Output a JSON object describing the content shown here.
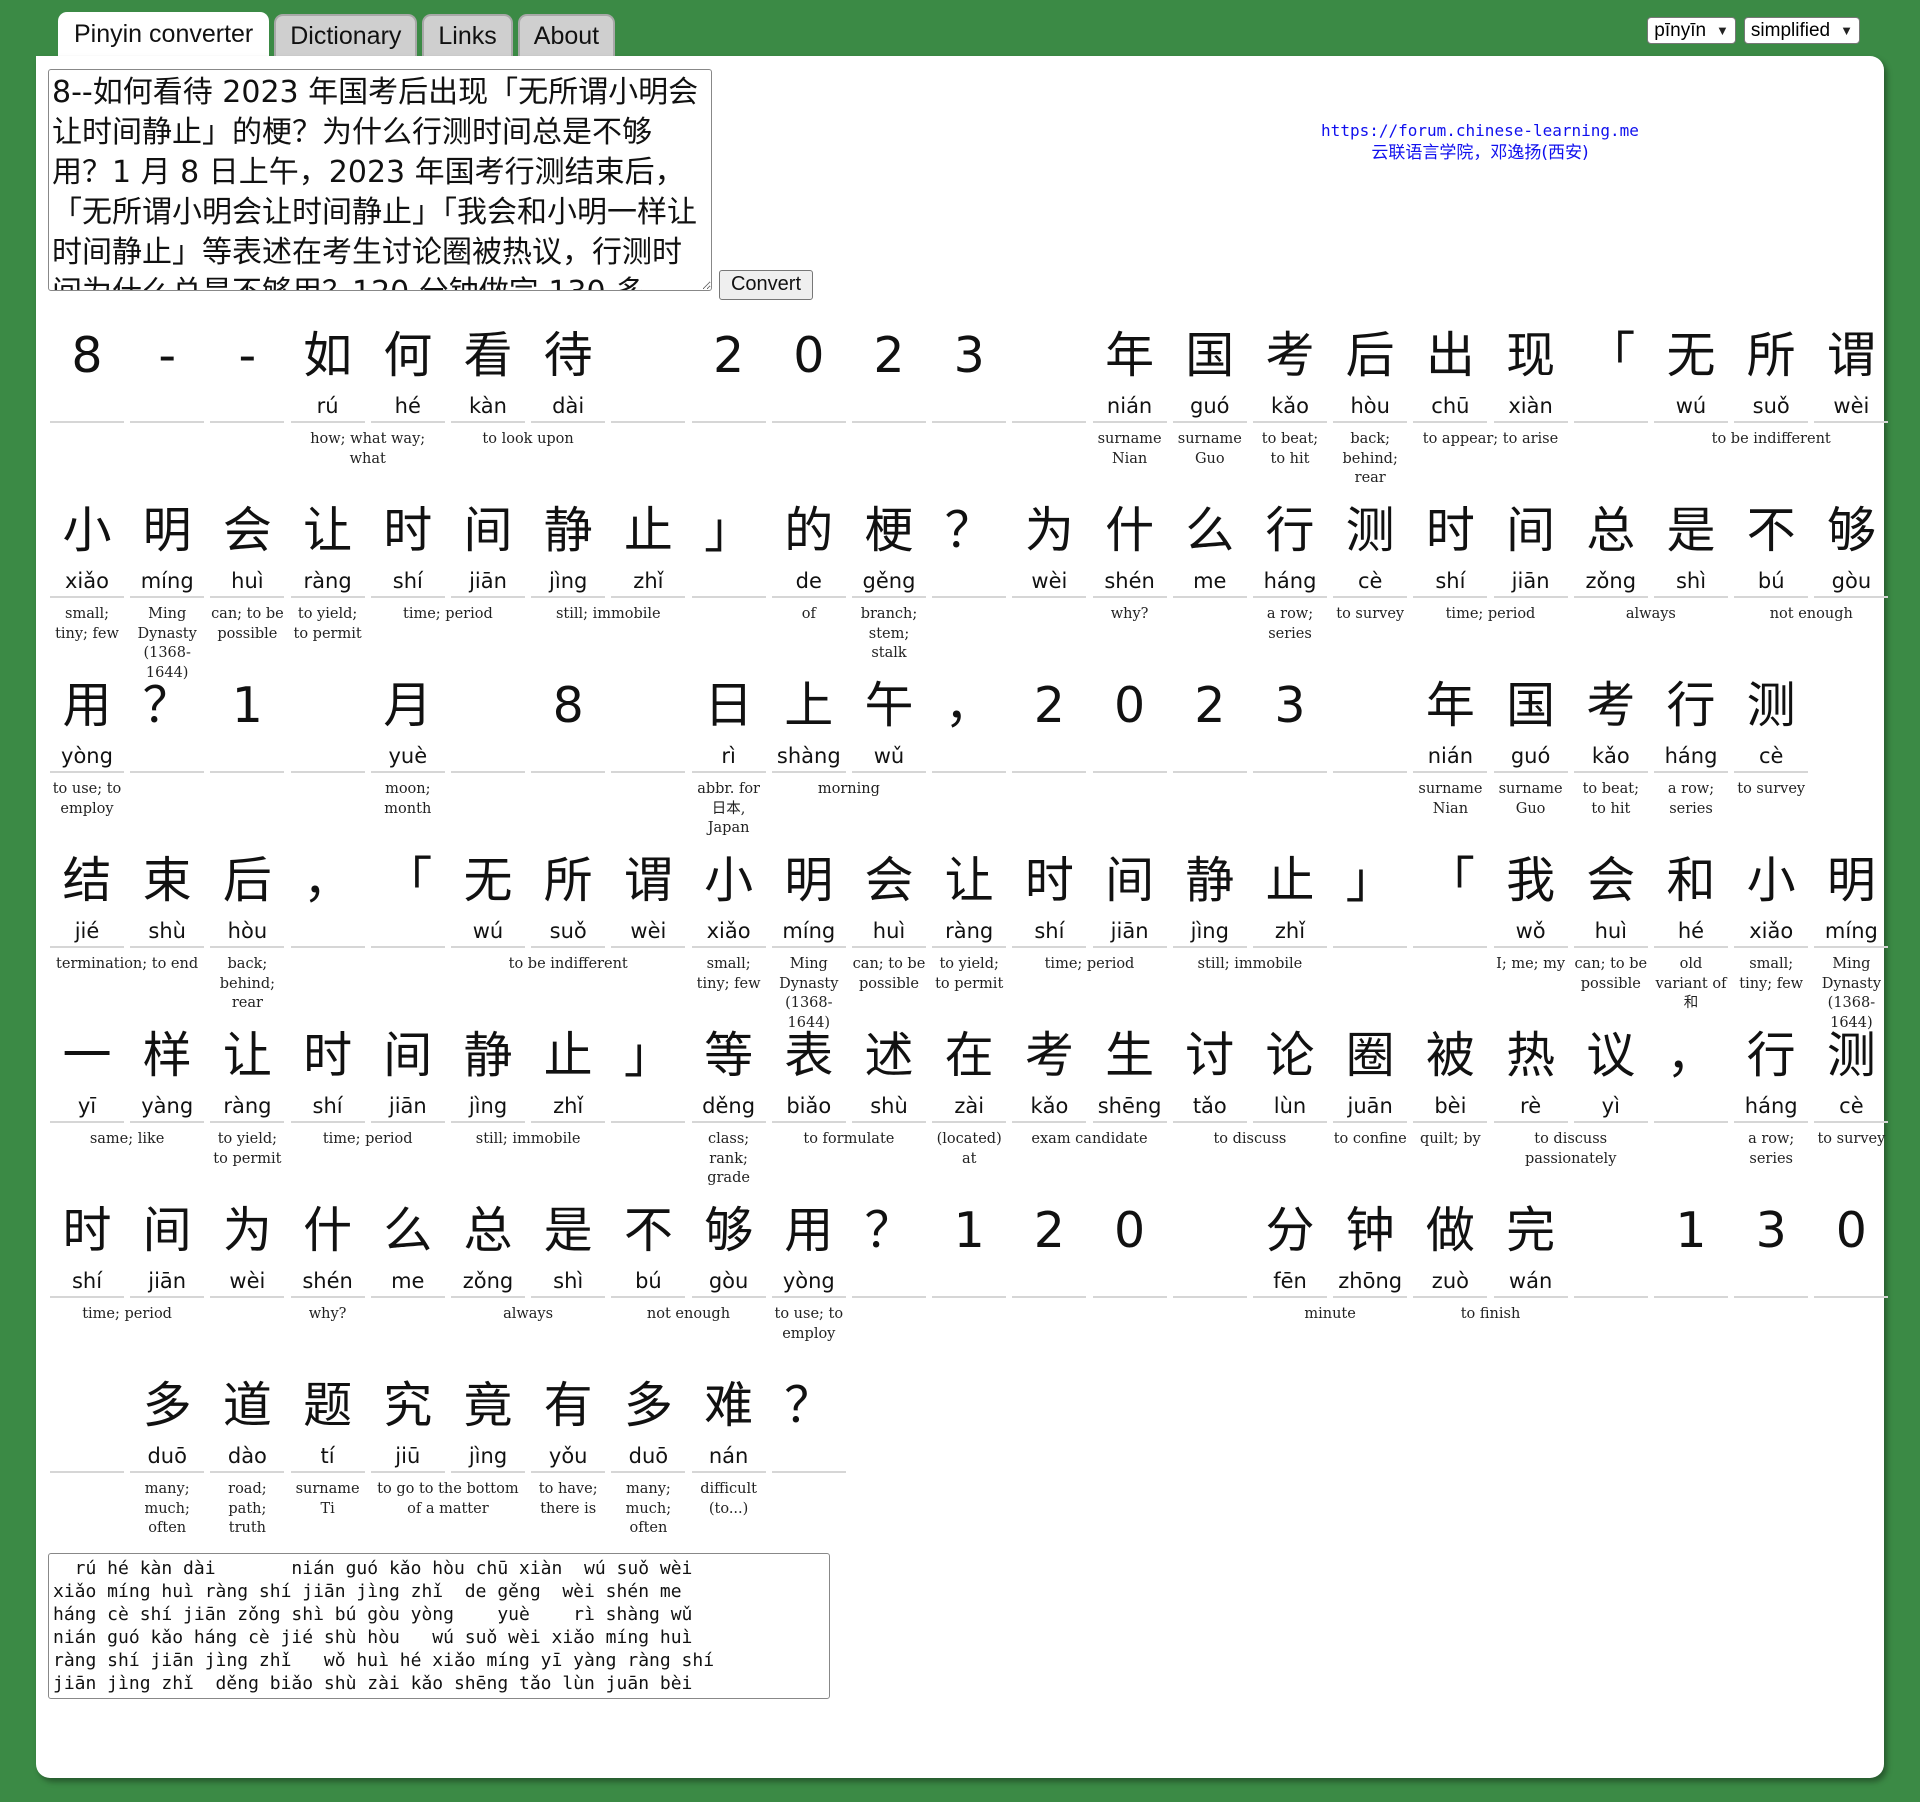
{
  "tabs": [
    "Pinyin converter",
    "Dictionary",
    "Links",
    "About"
  ],
  "active_tab": 0,
  "selects": {
    "mode": "pīnyīn",
    "script": "simplified"
  },
  "input_text": "8--如何看待 2023 年国考后出现「无所谓小明会让时间静止」的梗？为什么行测时间总是不够用？1 月 8 日上午，2023 年国考行测结束后，「无所谓小明会让时间静止」「我会和小明一样让时间静止」等表述在考生讨论圈被热议，行测时间为什么总是不够用？120 分钟做完 130 多",
  "convert_label": "Convert",
  "forum": {
    "url": "https://forum.chinese-learning.me",
    "subtitle": "云联语言学院，邓逸扬(西安)"
  },
  "lines": [
    {
      "cells": [
        {
          "c": "8",
          "p": ""
        },
        {
          "c": "-",
          "p": ""
        },
        {
          "c": "-",
          "p": ""
        },
        {
          "c": "如",
          "p": "rú"
        },
        {
          "c": "何",
          "p": "hé"
        },
        {
          "c": "看",
          "p": "kàn"
        },
        {
          "c": "待",
          "p": "dài"
        },
        {
          "c": "",
          "p": ""
        },
        {
          "c": "2",
          "p": ""
        },
        {
          "c": "0",
          "p": ""
        },
        {
          "c": "2",
          "p": ""
        },
        {
          "c": "3",
          "p": ""
        },
        {
          "c": "",
          "p": ""
        },
        {
          "c": "年",
          "p": "nián"
        },
        {
          "c": "国",
          "p": "guó"
        },
        {
          "c": "考",
          "p": "kǎo"
        },
        {
          "c": "后",
          "p": "hòu"
        },
        {
          "c": "出",
          "p": "chū"
        },
        {
          "c": "现",
          "p": "xiàn"
        },
        {
          "c": "「",
          "p": ""
        },
        {
          "c": "无",
          "p": "wú"
        },
        {
          "c": "所",
          "p": "suǒ"
        },
        {
          "c": "谓",
          "p": "wèi"
        }
      ],
      "defs": [
        {
          "s": 3,
          "n": 2,
          "t": "how; what way; what"
        },
        {
          "s": 5,
          "n": 2,
          "t": "to look upon"
        },
        {
          "s": 13,
          "n": 1,
          "t": "surname Nian"
        },
        {
          "s": 14,
          "n": 1,
          "t": "surname Guo"
        },
        {
          "s": 15,
          "n": 1,
          "t": "to beat; to hit"
        },
        {
          "s": 16,
          "n": 1,
          "t": "back; behind; rear"
        },
        {
          "s": 17,
          "n": 2,
          "t": "to appear; to arise"
        },
        {
          "s": 20,
          "n": 3,
          "t": "to be indifferent"
        }
      ]
    },
    {
      "cells": [
        {
          "c": "小",
          "p": "xiǎo"
        },
        {
          "c": "明",
          "p": "míng"
        },
        {
          "c": "会",
          "p": "huì"
        },
        {
          "c": "让",
          "p": "ràng"
        },
        {
          "c": "时",
          "p": "shí"
        },
        {
          "c": "间",
          "p": "jiān"
        },
        {
          "c": "静",
          "p": "jìng"
        },
        {
          "c": "止",
          "p": "zhǐ"
        },
        {
          "c": "」",
          "p": ""
        },
        {
          "c": "的",
          "p": "de"
        },
        {
          "c": "梗",
          "p": "gěng"
        },
        {
          "c": "？",
          "p": ""
        },
        {
          "c": "为",
          "p": "wèi"
        },
        {
          "c": "什",
          "p": "shén"
        },
        {
          "c": "么",
          "p": "me"
        },
        {
          "c": "行",
          "p": "háng"
        },
        {
          "c": "测",
          "p": "cè"
        },
        {
          "c": "时",
          "p": "shí"
        },
        {
          "c": "间",
          "p": "jiān"
        },
        {
          "c": "总",
          "p": "zǒng"
        },
        {
          "c": "是",
          "p": "shì"
        },
        {
          "c": "不",
          "p": "bú"
        },
        {
          "c": "够",
          "p": "gòu"
        }
      ],
      "defs": [
        {
          "s": 0,
          "n": 1,
          "t": "small; tiny; few"
        },
        {
          "s": 1,
          "n": 1,
          "t": "Ming Dynasty (1368-1644)"
        },
        {
          "s": 2,
          "n": 1,
          "t": "can; to be possible"
        },
        {
          "s": 3,
          "n": 1,
          "t": "to yield; to permit"
        },
        {
          "s": 4,
          "n": 2,
          "t": "time; period"
        },
        {
          "s": 6,
          "n": 2,
          "t": "still; immobile"
        },
        {
          "s": 9,
          "n": 1,
          "t": "of"
        },
        {
          "s": 10,
          "n": 1,
          "t": "branch; stem; stalk"
        },
        {
          "s": 12,
          "n": 3,
          "t": "why?"
        },
        {
          "s": 15,
          "n": 1,
          "t": "a row; series"
        },
        {
          "s": 16,
          "n": 1,
          "t": "to survey"
        },
        {
          "s": 17,
          "n": 2,
          "t": "time; period"
        },
        {
          "s": 19,
          "n": 2,
          "t": "always"
        },
        {
          "s": 21,
          "n": 2,
          "t": "not enough"
        }
      ]
    },
    {
      "cells": [
        {
          "c": "用",
          "p": "yòng"
        },
        {
          "c": "？",
          "p": ""
        },
        {
          "c": "1",
          "p": ""
        },
        {
          "c": "",
          "p": ""
        },
        {
          "c": "月",
          "p": "yuè"
        },
        {
          "c": "",
          "p": ""
        },
        {
          "c": "8",
          "p": ""
        },
        {
          "c": "",
          "p": ""
        },
        {
          "c": "日",
          "p": "rì"
        },
        {
          "c": "上",
          "p": "shàng"
        },
        {
          "c": "午",
          "p": "wǔ"
        },
        {
          "c": "，",
          "p": ""
        },
        {
          "c": "2",
          "p": ""
        },
        {
          "c": "0",
          "p": ""
        },
        {
          "c": "2",
          "p": ""
        },
        {
          "c": "3",
          "p": ""
        },
        {
          "c": "",
          "p": ""
        },
        {
          "c": "年",
          "p": "nián"
        },
        {
          "c": "国",
          "p": "guó"
        },
        {
          "c": "考",
          "p": "kǎo"
        },
        {
          "c": "行",
          "p": "háng"
        },
        {
          "c": "测",
          "p": "cè"
        }
      ],
      "defs": [
        {
          "s": 0,
          "n": 1,
          "t": "to use; to employ"
        },
        {
          "s": 4,
          "n": 1,
          "t": "moon; month"
        },
        {
          "s": 8,
          "n": 1,
          "t": "abbr. for 日本, Japan"
        },
        {
          "s": 9,
          "n": 2,
          "t": "morning"
        },
        {
          "s": 17,
          "n": 1,
          "t": "surname Nian"
        },
        {
          "s": 18,
          "n": 1,
          "t": "surname Guo"
        },
        {
          "s": 19,
          "n": 1,
          "t": "to beat; to hit"
        },
        {
          "s": 20,
          "n": 1,
          "t": "a row; series"
        },
        {
          "s": 21,
          "n": 1,
          "t": "to survey"
        }
      ]
    },
    {
      "cells": [
        {
          "c": "结",
          "p": "jié"
        },
        {
          "c": "束",
          "p": "shù"
        },
        {
          "c": "后",
          "p": "hòu"
        },
        {
          "c": "，",
          "p": ""
        },
        {
          "c": "「",
          "p": ""
        },
        {
          "c": "无",
          "p": "wú"
        },
        {
          "c": "所",
          "p": "suǒ"
        },
        {
          "c": "谓",
          "p": "wèi"
        },
        {
          "c": "小",
          "p": "xiǎo"
        },
        {
          "c": "明",
          "p": "míng"
        },
        {
          "c": "会",
          "p": "huì"
        },
        {
          "c": "让",
          "p": "ràng"
        },
        {
          "c": "时",
          "p": "shí"
        },
        {
          "c": "间",
          "p": "jiān"
        },
        {
          "c": "静",
          "p": "jìng"
        },
        {
          "c": "止",
          "p": "zhǐ"
        },
        {
          "c": "」",
          "p": ""
        },
        {
          "c": "「",
          "p": ""
        },
        {
          "c": "我",
          "p": "wǒ"
        },
        {
          "c": "会",
          "p": "huì"
        },
        {
          "c": "和",
          "p": "hé"
        },
        {
          "c": "小",
          "p": "xiǎo"
        },
        {
          "c": "明",
          "p": "míng"
        }
      ],
      "defs": [
        {
          "s": 0,
          "n": 2,
          "t": "termination; to end"
        },
        {
          "s": 2,
          "n": 1,
          "t": "back; behind; rear"
        },
        {
          "s": 5,
          "n": 3,
          "t": "to be indifferent"
        },
        {
          "s": 8,
          "n": 1,
          "t": "small; tiny; few"
        },
        {
          "s": 9,
          "n": 1,
          "t": "Ming Dynasty (1368-1644)"
        },
        {
          "s": 10,
          "n": 1,
          "t": "can; to be possible"
        },
        {
          "s": 11,
          "n": 1,
          "t": "to yield; to permit"
        },
        {
          "s": 12,
          "n": 2,
          "t": "time; period"
        },
        {
          "s": 14,
          "n": 2,
          "t": "still; immobile"
        },
        {
          "s": 18,
          "n": 1,
          "t": "I; me; my"
        },
        {
          "s": 19,
          "n": 1,
          "t": "can; to be possible"
        },
        {
          "s": 20,
          "n": 1,
          "t": "old variant of 和"
        },
        {
          "s": 21,
          "n": 1,
          "t": "small; tiny; few"
        },
        {
          "s": 22,
          "n": 1,
          "t": "Ming Dynasty (1368-1644)"
        }
      ]
    },
    {
      "cells": [
        {
          "c": "一",
          "p": "yī"
        },
        {
          "c": "样",
          "p": "yàng"
        },
        {
          "c": "让",
          "p": "ràng"
        },
        {
          "c": "时",
          "p": "shí"
        },
        {
          "c": "间",
          "p": "jiān"
        },
        {
          "c": "静",
          "p": "jìng"
        },
        {
          "c": "止",
          "p": "zhǐ"
        },
        {
          "c": "」",
          "p": ""
        },
        {
          "c": "等",
          "p": "děng"
        },
        {
          "c": "表",
          "p": "biǎo"
        },
        {
          "c": "述",
          "p": "shù"
        },
        {
          "c": "在",
          "p": "zài"
        },
        {
          "c": "考",
          "p": "kǎo"
        },
        {
          "c": "生",
          "p": "shēng"
        },
        {
          "c": "讨",
          "p": "tǎo"
        },
        {
          "c": "论",
          "p": "lùn"
        },
        {
          "c": "圈",
          "p": "juān"
        },
        {
          "c": "被",
          "p": "bèi"
        },
        {
          "c": "热",
          "p": "rè"
        },
        {
          "c": "议",
          "p": "yì"
        },
        {
          "c": "，",
          "p": ""
        },
        {
          "c": "行",
          "p": "háng"
        },
        {
          "c": "测",
          "p": "cè"
        }
      ],
      "defs": [
        {
          "s": 0,
          "n": 2,
          "t": "same; like"
        },
        {
          "s": 2,
          "n": 1,
          "t": "to yield; to permit"
        },
        {
          "s": 3,
          "n": 2,
          "t": "time; period"
        },
        {
          "s": 5,
          "n": 2,
          "t": "still; immobile"
        },
        {
          "s": 8,
          "n": 1,
          "t": "class; rank; grade"
        },
        {
          "s": 9,
          "n": 2,
          "t": "to formulate"
        },
        {
          "s": 11,
          "n": 1,
          "t": "(located) at"
        },
        {
          "s": 12,
          "n": 2,
          "t": "exam candidate"
        },
        {
          "s": 14,
          "n": 2,
          "t": "to discuss"
        },
        {
          "s": 16,
          "n": 1,
          "t": "to confine"
        },
        {
          "s": 17,
          "n": 1,
          "t": "quilt; by"
        },
        {
          "s": 18,
          "n": 2,
          "t": "to discuss passionately"
        },
        {
          "s": 21,
          "n": 1,
          "t": "a row; series"
        },
        {
          "s": 22,
          "n": 1,
          "t": "to survey"
        }
      ]
    },
    {
      "cells": [
        {
          "c": "时",
          "p": "shí"
        },
        {
          "c": "间",
          "p": "jiān"
        },
        {
          "c": "为",
          "p": "wèi"
        },
        {
          "c": "什",
          "p": "shén"
        },
        {
          "c": "么",
          "p": "me"
        },
        {
          "c": "总",
          "p": "zǒng"
        },
        {
          "c": "是",
          "p": "shì"
        },
        {
          "c": "不",
          "p": "bú"
        },
        {
          "c": "够",
          "p": "gòu"
        },
        {
          "c": "用",
          "p": "yòng"
        },
        {
          "c": "？",
          "p": ""
        },
        {
          "c": "1",
          "p": ""
        },
        {
          "c": "2",
          "p": ""
        },
        {
          "c": "0",
          "p": ""
        },
        {
          "c": "",
          "p": ""
        },
        {
          "c": "分",
          "p": "fēn"
        },
        {
          "c": "钟",
          "p": "zhōng"
        },
        {
          "c": "做",
          "p": "zuò"
        },
        {
          "c": "完",
          "p": "wán"
        },
        {
          "c": "",
          "p": ""
        },
        {
          "c": "1",
          "p": ""
        },
        {
          "c": "3",
          "p": ""
        },
        {
          "c": "0",
          "p": ""
        }
      ],
      "defs": [
        {
          "s": 0,
          "n": 2,
          "t": "time; period"
        },
        {
          "s": 2,
          "n": 3,
          "t": "why?"
        },
        {
          "s": 5,
          "n": 2,
          "t": "always"
        },
        {
          "s": 7,
          "n": 2,
          "t": "not enough"
        },
        {
          "s": 9,
          "n": 1,
          "t": "to use; to employ"
        },
        {
          "s": 15,
          "n": 2,
          "t": "minute"
        },
        {
          "s": 17,
          "n": 2,
          "t": "to finish"
        }
      ]
    },
    {
      "cells": [
        {
          "c": "",
          "p": ""
        },
        {
          "c": "多",
          "p": "duō"
        },
        {
          "c": "道",
          "p": "dào"
        },
        {
          "c": "题",
          "p": "tí"
        },
        {
          "c": "究",
          "p": "jiū"
        },
        {
          "c": "竟",
          "p": "jìng"
        },
        {
          "c": "有",
          "p": "yǒu"
        },
        {
          "c": "多",
          "p": "duō"
        },
        {
          "c": "难",
          "p": "nán"
        },
        {
          "c": "？",
          "p": ""
        }
      ],
      "defs": [
        {
          "s": 1,
          "n": 1,
          "t": "many; much; often"
        },
        {
          "s": 2,
          "n": 1,
          "t": "road; path; truth"
        },
        {
          "s": 3,
          "n": 1,
          "t": "surname Ti"
        },
        {
          "s": 4,
          "n": 2,
          "t": "to go to the bottom of a matter"
        },
        {
          "s": 6,
          "n": 1,
          "t": "to have; there is"
        },
        {
          "s": 7,
          "n": 1,
          "t": "many; much; often"
        },
        {
          "s": 8,
          "n": 1,
          "t": "difficult (to...)"
        }
      ]
    }
  ],
  "output_lines": [
    "  rú hé kàn dài       nián guó kǎo hòu chū xiàn  wú suǒ wèi",
    "xiǎo míng huì ràng shí jiān jìng zhǐ  de gěng  wèi shén me",
    "háng cè shí jiān zǒng shì bú gòu yòng    yuè    rì shàng wǔ",
    "nián guó kǎo háng cè jié shù hòu   wú suǒ wèi xiǎo míng huì",
    "ràng shí jiān jìng zhǐ   wǒ huì hé xiǎo míng yī yàng ràng shí",
    "jiān jìng zhǐ  děng biǎo shù zài kǎo shēng tǎo lùn juān bèi"
  ]
}
